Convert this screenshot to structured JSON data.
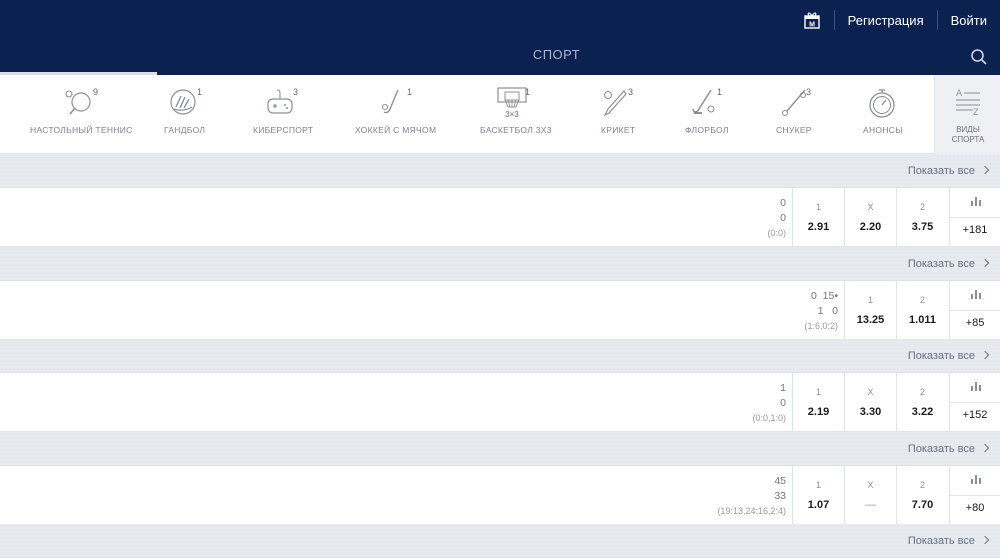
{
  "header": {
    "register_label": "Регистрация",
    "login_label": "Войти",
    "section_title": "СПОРТ"
  },
  "sports": [
    {
      "label": "НАСТОЛЬНЫЙ ТЕННИС",
      "count": "9",
      "icon": "table-tennis-icon"
    },
    {
      "label": "ГАНДБОЛ",
      "count": "1",
      "icon": "handball-icon"
    },
    {
      "label": "КИБЕРСПОРТ",
      "count": "3",
      "icon": "gamepad-icon"
    },
    {
      "label": "ХОККЕЙ С МЯЧОМ",
      "count": "1",
      "icon": "bandy-icon"
    },
    {
      "label": "БАСКЕТБОЛ 3Х3",
      "count": "1",
      "icon": "basketball-3x3-icon"
    },
    {
      "label": "КРИКЕТ",
      "count": "3",
      "icon": "cricket-icon"
    },
    {
      "label": "ФЛОРБОЛ",
      "count": "1",
      "icon": "floorball-icon"
    },
    {
      "label": "СНУКЕР",
      "count": "3",
      "icon": "snooker-icon"
    },
    {
      "label": "АНОНСЫ",
      "count": "",
      "icon": "stopwatch-icon"
    }
  ],
  "kinds_label_1": "ВИДЫ",
  "kinds_label_2": "СПОРТА",
  "show_all_label": "Показать все",
  "events": [
    {
      "score_lines": [
        "0",
        "0"
      ],
      "score_sub": "(0:0)",
      "odds": [
        {
          "label": "1",
          "value": "2.91"
        },
        {
          "label": "X",
          "value": "2.20"
        },
        {
          "label": "2",
          "value": "3.75"
        }
      ],
      "more": "+181"
    },
    {
      "score_lines": [
        "0  15•",
        "1   0"
      ],
      "score_sub": "(1:6,0:2)",
      "odds": [
        {
          "label": "1",
          "value": "13.25"
        },
        {
          "label": "2",
          "value": "1.011"
        }
      ],
      "more": "+85"
    },
    {
      "score_lines": [
        "1",
        "0"
      ],
      "score_sub": "(0:0,1:0)",
      "odds": [
        {
          "label": "1",
          "value": "2.19"
        },
        {
          "label": "X",
          "value": "3.30"
        },
        {
          "label": "2",
          "value": "3.22"
        }
      ],
      "more": "+152"
    },
    {
      "score_lines": [
        "45",
        "33"
      ],
      "score_sub": "(19:13,24:16,2:4)",
      "odds": [
        {
          "label": "1",
          "value": "1.07"
        },
        {
          "label": "X",
          "value": "—"
        },
        {
          "label": "2",
          "value": "7.70"
        }
      ],
      "more": "+80"
    }
  ],
  "colors": {
    "header_bg": "#0b2150",
    "group_bg": "#e7eaef"
  }
}
